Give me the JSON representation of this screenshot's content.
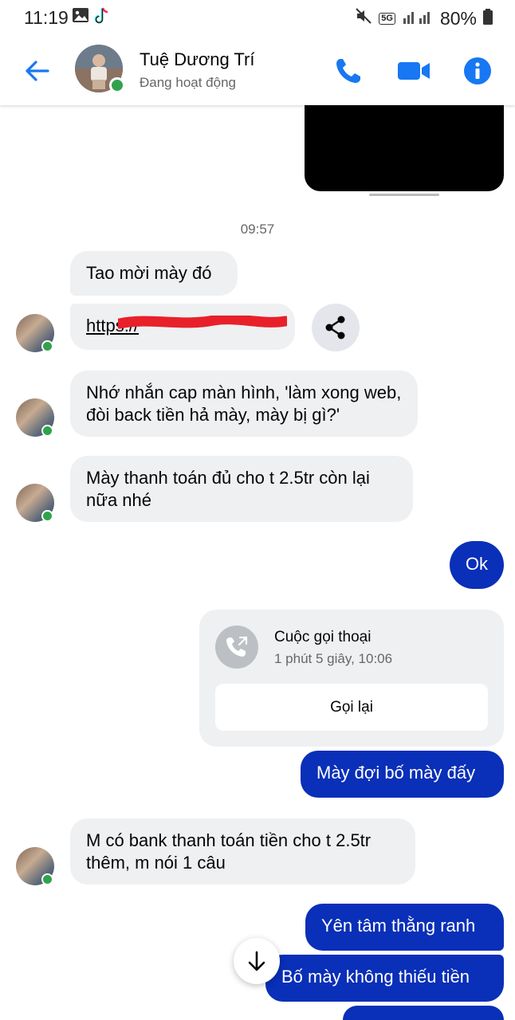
{
  "status_bar": {
    "time": "11:19",
    "network": "5G",
    "battery": "80%",
    "icons": [
      "image-icon",
      "tiktok-icon",
      "mute-icon",
      "signal-icon",
      "battery-icon"
    ]
  },
  "header": {
    "contact_name": "Tuệ Dương Trí",
    "contact_status": "Đang hoạt động",
    "actions": [
      "back-arrow-icon",
      "phone-icon",
      "video-camera-icon",
      "info-icon"
    ],
    "accent_color": "#1877f2"
  },
  "thread": {
    "timestamp": "09:57",
    "messages": [
      {
        "from": "them",
        "text": "Tao mời mày đó"
      },
      {
        "from": "them",
        "text": "https://",
        "kind": "link",
        "note": "redacted"
      },
      {
        "from": "them",
        "text": "Nhớ nhắn cap màn hình, 'làm xong web, đòi back tiền hả mày, mày bị gì?'"
      },
      {
        "from": "them",
        "text": "Mày thanh toán đủ cho t 2.5tr còn lại nữa nhé"
      },
      {
        "from": "me",
        "text": "Ok"
      },
      {
        "from": "me",
        "kind": "call",
        "title": "Cuộc gọi thoại",
        "detail": "1 phút 5 giây, 10:06",
        "button": "Gọi lại"
      },
      {
        "from": "me",
        "text": "Mày đợi bố mày đấy"
      },
      {
        "from": "them",
        "text": "M có bank thanh toán tiền cho t 2.5tr thêm, m nói 1 câu"
      },
      {
        "from": "me",
        "text": "Yên tâm thằng ranh"
      },
      {
        "from": "me",
        "text": "Bố mày không thiếu tiền"
      }
    ]
  },
  "colors": {
    "outgoing_bubble": "#0a2fb8",
    "incoming_bubble": "#eff0f2",
    "online_dot": "#31a24c",
    "redaction": "#e8202a"
  }
}
